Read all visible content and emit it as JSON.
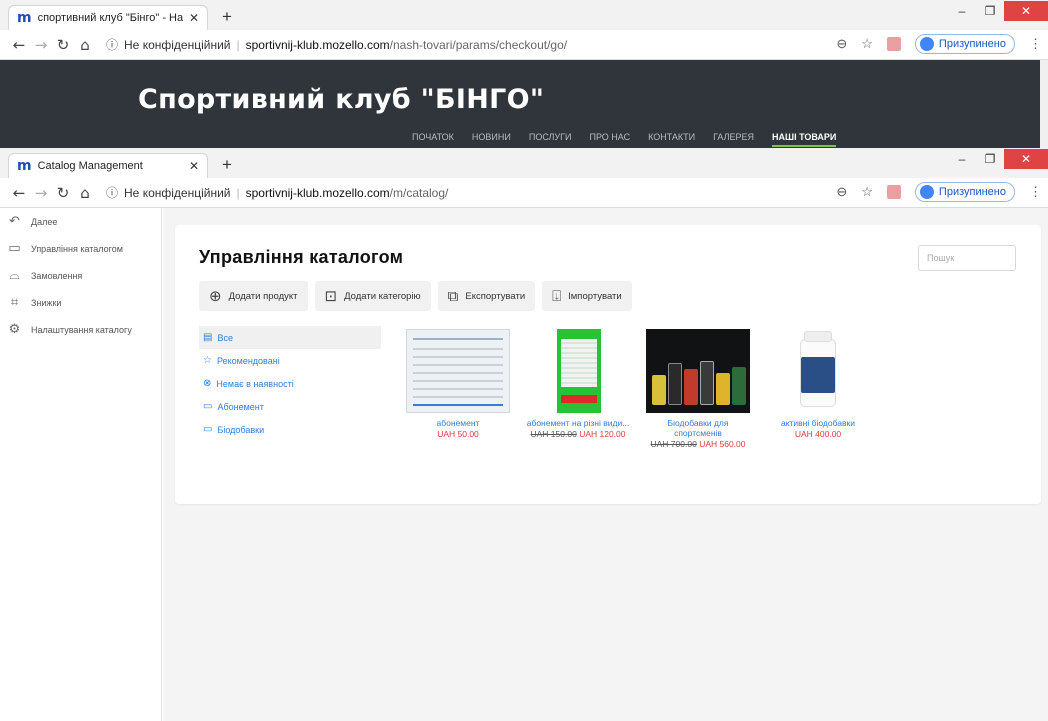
{
  "window1": {
    "tab_title": "спортивний клуб \"Бінго\" - Наші",
    "url_info": "Не конфіденційний",
    "url_host": "sportivnij-klub.mozello.com",
    "url_path": "/nash-tovari/params/checkout/go/",
    "profile": "Призупинено"
  },
  "site": {
    "title": "Спортивний клуб \"БІНГО\"",
    "nav": [
      "ПОЧАТОК",
      "НОВИНИ",
      "ПОСЛУГИ",
      "ПРО НАС",
      "КОНТАКТИ",
      "ГАЛЕРЕЯ",
      "НАШІ ТОВАРИ"
    ],
    "nav_active_index": 6,
    "accent": "#7cc24e"
  },
  "window2": {
    "tab_title": "Catalog Management",
    "url_info": "Не конфіденційний",
    "url_host": "sportivnij-klub.mozello.com",
    "url_path": "/m/catalog/",
    "profile": "Призупинено"
  },
  "sidebar": {
    "items": [
      {
        "label": "Далее",
        "icon": "back-arrow-icon"
      },
      {
        "label": "Управління каталогом",
        "icon": "box-icon"
      },
      {
        "label": "Замовлення",
        "icon": "basket-icon"
      },
      {
        "label": "Знижки",
        "icon": "tag-icon"
      },
      {
        "label": "Налаштування каталогу",
        "icon": "gear-icon"
      }
    ]
  },
  "catalog": {
    "title": "Управління каталогом",
    "search_placeholder": "Пошук",
    "toolbar": [
      {
        "label": "Додати продукт",
        "icon": "plus-circle-icon"
      },
      {
        "label": "Додати категорію",
        "icon": "add-folder-icon"
      },
      {
        "label": "Експортувати",
        "icon": "export-icon"
      },
      {
        "label": "Імпортувати",
        "icon": "import-icon"
      }
    ],
    "filters": [
      {
        "label": "Все",
        "icon": "all-icon"
      },
      {
        "label": "Рекомендовані",
        "icon": "star-icon"
      },
      {
        "label": "Немає в наявності",
        "icon": "x-circle-icon"
      },
      {
        "label": "Абонемент",
        "icon": "folder-icon"
      },
      {
        "label": "Біодобавки",
        "icon": "folder-icon"
      }
    ],
    "products": [
      {
        "name": "абонемент",
        "old_price": "",
        "price": "UAH 50.00"
      },
      {
        "name": "абонемент на різні види...",
        "old_price": "UAH 150.00",
        "price": "UAH 120.00"
      },
      {
        "name": "Біодобавки для спортсменів",
        "old_price": "UAH 700.00",
        "price": "UAH 560.00"
      },
      {
        "name": "активні біодобавки",
        "old_price": "",
        "price": "UAH 400.00"
      }
    ],
    "link_color": "#2f7de0",
    "price_color": "#e23b3b"
  }
}
